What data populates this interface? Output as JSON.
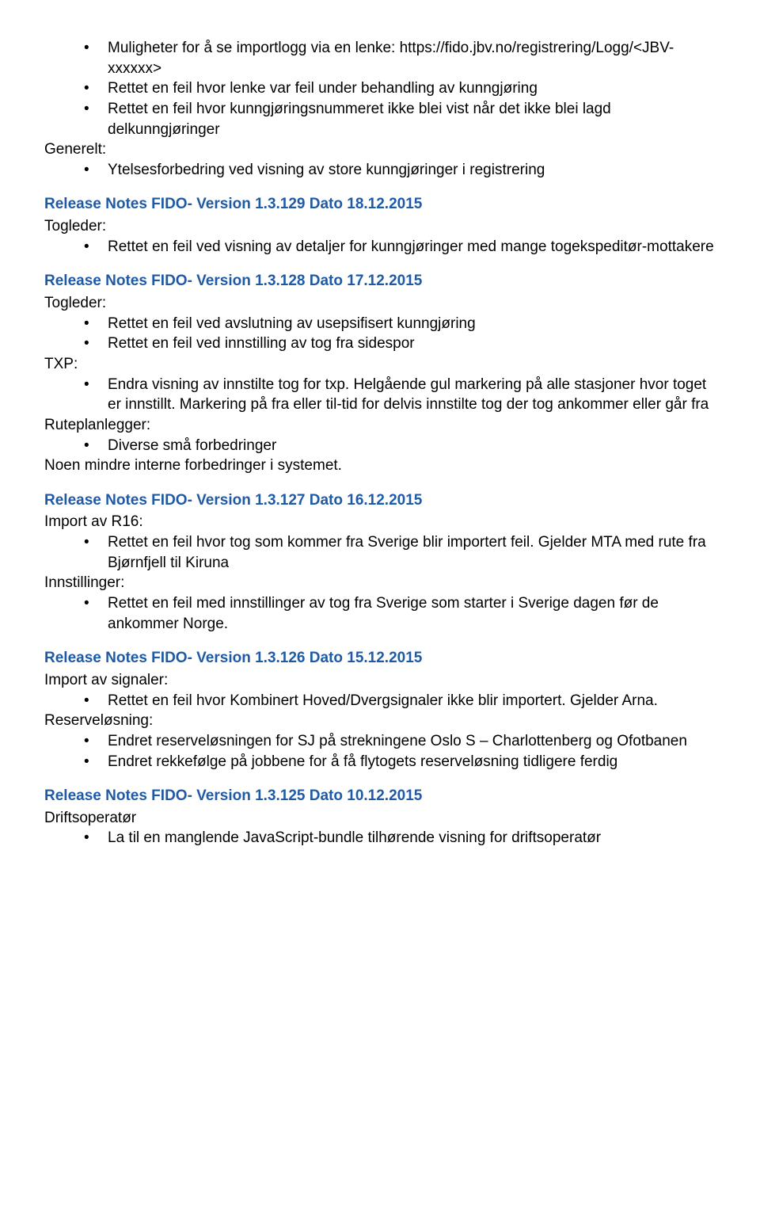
{
  "block1": {
    "items1": [
      "Muligheter for å se importlogg via en lenke: https://fido.jbv.no/registrering/Logg/<JBV-xxxxxx>",
      "Rettet en feil hvor lenke var feil under behandling av kunngjøring",
      "Rettet en feil hvor kunngjøringsnummeret ikke blei vist når det ikke blei lagd delkunngjøringer"
    ],
    "label1": "Generelt:",
    "items2": [
      "Ytelsesforbedring ved visning av store kunngjøringer i registrering"
    ]
  },
  "h129": "Release Notes FIDO- Version 1.3.129 Dato 18.12.2015",
  "block129": {
    "label1": "Togleder:",
    "items1": [
      "Rettet en feil ved visning av detaljer for kunngjøringer med mange togekspeditør-mottakere"
    ]
  },
  "h128": "Release Notes FIDO- Version 1.3.128 Dato 17.12.2015",
  "block128": {
    "label1": "Togleder:",
    "items1": [
      "Rettet en feil ved avslutning av usepsifisert kunngjøring",
      "Rettet en feil ved innstilling av tog fra sidespor"
    ],
    "label2": "TXP:",
    "items2": [
      "Endra visning av innstilte tog for txp. Helgående gul markering på alle stasjoner hvor toget er innstillt. Markering på fra eller til-tid for delvis innstilte tog der tog ankommer eller går fra"
    ],
    "label3": "Ruteplanlegger:",
    "items3": [
      "Diverse små forbedringer"
    ],
    "para4": "Noen mindre interne forbedringer i systemet."
  },
  "h127": "Release Notes FIDO- Version 1.3.127 Dato 16.12.2015",
  "block127": {
    "label1": "Import av R16:",
    "items1": [
      "Rettet en feil hvor tog som kommer fra Sverige blir importert feil. Gjelder MTA med rute fra Bjørnfjell til Kiruna"
    ],
    "label2": "Innstillinger:",
    "items2": [
      "Rettet en feil med innstillinger av tog fra Sverige som starter i Sverige dagen før de ankommer Norge."
    ]
  },
  "h126": "Release Notes FIDO- Version 1.3.126 Dato 15.12.2015",
  "block126": {
    "label1": "Import av signaler:",
    "items1": [
      "Rettet en feil hvor Kombinert Hoved/Dvergsignaler ikke blir importert. Gjelder Arna."
    ],
    "label2": "Reserveløsning:",
    "items2": [
      "Endret reserveløsningen for SJ på strekningene Oslo S – Charlottenberg og Ofotbanen",
      "Endret rekkefølge på jobbene for å få flytogets reserveløsning tidligere ferdig"
    ]
  },
  "h125": "Release Notes FIDO- Version 1.3.125 Dato 10.12.2015",
  "block125": {
    "label1": "Driftsoperatør",
    "items1": [
      "La til en manglende JavaScript-bundle tilhørende visning for driftsoperatør"
    ]
  }
}
